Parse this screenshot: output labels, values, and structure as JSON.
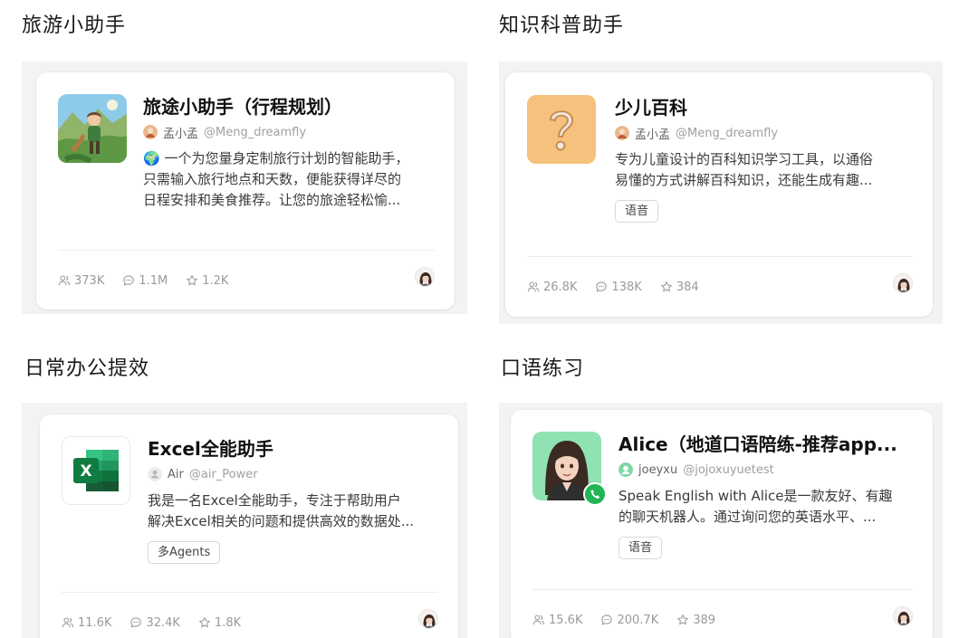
{
  "sections": [
    {
      "title": "旅游小助手",
      "card": {
        "title": "旅途小助手（行程规划）",
        "author": "孟小孟",
        "handle": "@Meng_dreamfly",
        "desc_lines": [
          "🌍 一个为您量身定制旅行计划的智能助手，",
          "只需输入旅行地点和天数，便能获得详尽的",
          "日程安排和美食推荐。让您的旅途轻松愉..."
        ],
        "tag": "",
        "stats": {
          "users": "373K",
          "messages": "1.1M",
          "stars": "1.2K"
        }
      }
    },
    {
      "title": "知识科普助手",
      "card": {
        "title": "少儿百科",
        "author": "孟小孟",
        "handle": "@Meng_dreamfly",
        "desc_lines": [
          "专为儿童设计的百科知识学习工具，以通俗",
          "易懂的方式讲解百科知识，还能生成有趣..."
        ],
        "tag": "语音",
        "stats": {
          "users": "26.8K",
          "messages": "138K",
          "stars": "384"
        }
      }
    },
    {
      "title": "日常办公提效",
      "card": {
        "title": "Excel全能助手",
        "author": "Air",
        "handle": "@air_Power",
        "desc_lines": [
          "我是一名Excel全能助手，专注于帮助用户",
          "解决Excel相关的问题和提供高效的数据处..."
        ],
        "tag": "多Agents",
        "stats": {
          "users": "11.6K",
          "messages": "32.4K",
          "stars": "1.8K"
        }
      }
    },
    {
      "title": "口语练习",
      "card": {
        "title": "Alice（地道口语陪练-推荐app...",
        "author": "joeyxu",
        "handle": "@jojoxuyuetest",
        "desc_lines": [
          "Speak English with Alice是一款友好、有趣",
          "的聊天机器人。通过询问您的英语水平、..."
        ],
        "tag": "语音",
        "stats": {
          "users": "15.6K",
          "messages": "200.7K",
          "stars": "389"
        }
      }
    }
  ],
  "icons": {
    "users": "users-icon",
    "messages": "chat-bubble-icon",
    "stars": "star-icon",
    "phone_badge": "phone-icon"
  },
  "colors": {
    "excel_green": "#1e7145",
    "question_bg": "#f6c17c",
    "phone_badge": "#22b455",
    "avatar_teal": "#7fd6a4"
  }
}
